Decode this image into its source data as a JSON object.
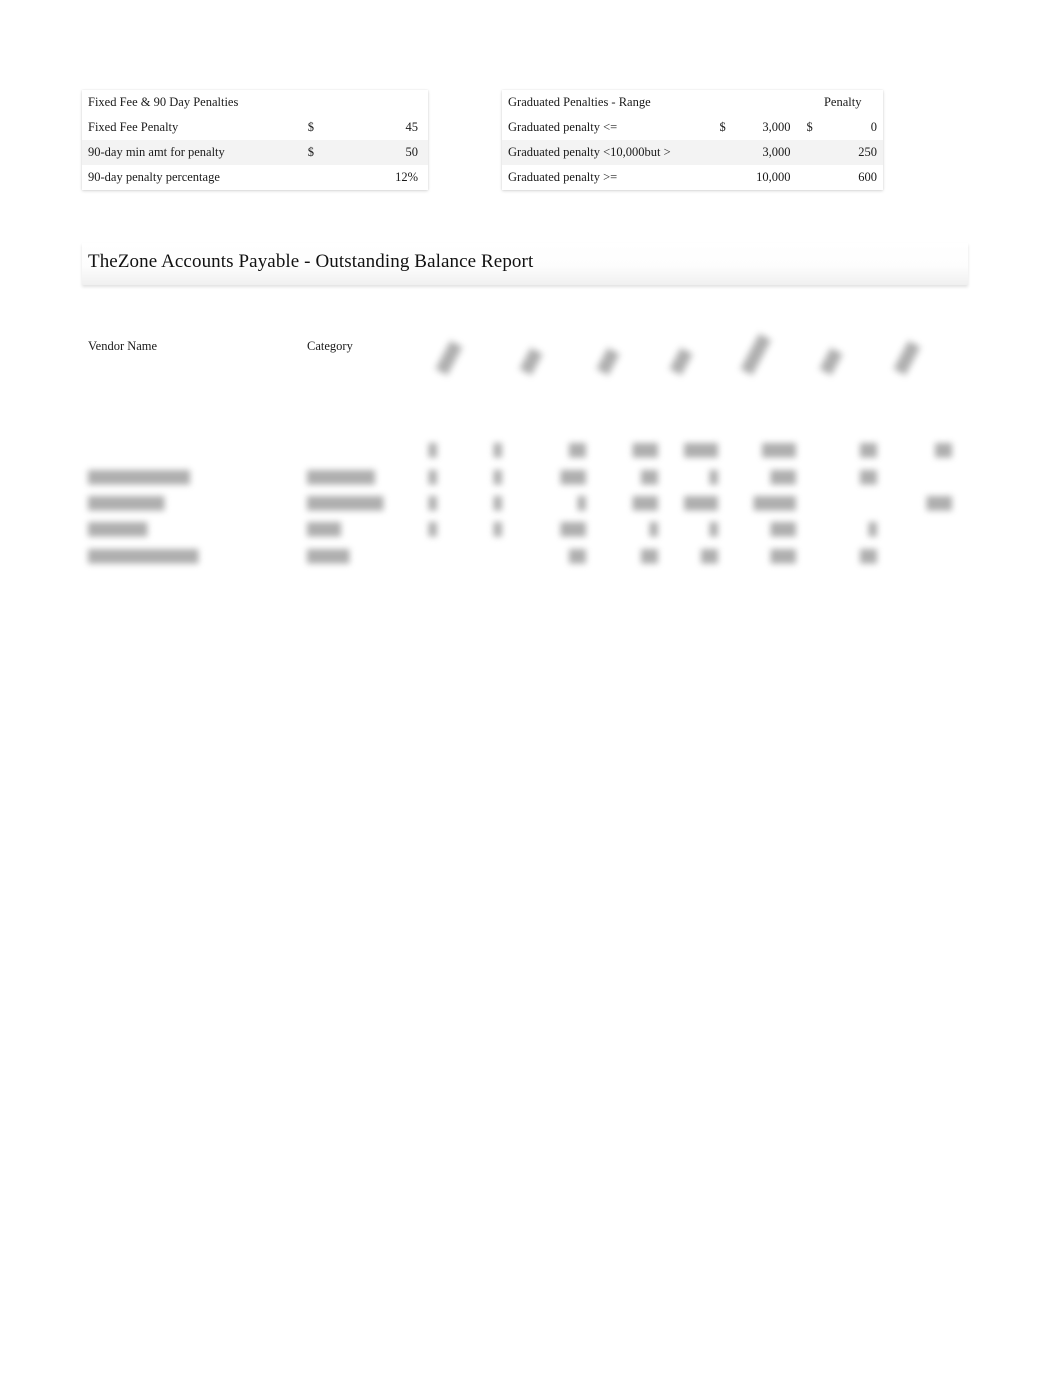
{
  "document": {
    "background_color": "#ffffff",
    "text_color": "#1a1a1a",
    "shade_color": "#f3f3f3"
  },
  "fixed_penalties_table": {
    "title": "Fixed   Fee & 90 Day Penalties",
    "rows": [
      {
        "label": "Fixed Fee Penalty",
        "currency": "$",
        "value": "45"
      },
      {
        "label": "90-day min amt for penalty",
        "currency": "$",
        "value": "50"
      },
      {
        "label": "90-day penalty percentage",
        "currency": "",
        "value": "12%"
      }
    ]
  },
  "graduated_penalties_table": {
    "title": "Graduated Penalties - Range",
    "penalty_header": "Penalty",
    "rows": [
      {
        "label": "Graduated penalty <=",
        "currency": "$",
        "range": "3,000",
        "penalty_currency": "$",
        "penalty": "0"
      },
      {
        "label": "Graduated penalty <10,000but >",
        "currency": "",
        "range": "3,000",
        "penalty_currency": "",
        "penalty": "250"
      },
      {
        "label": "Graduated penalty >=",
        "currency": "",
        "range": "10,000",
        "penalty_currency": "",
        "penalty": "600"
      }
    ]
  },
  "report": {
    "title": "TheZone Accounts Payable - Outstanding Balance Report",
    "column_headers": {
      "vendor_name": "Vendor Name",
      "category": "Category"
    },
    "rotated_headers": [
      {
        "label": "",
        "redacted": true
      },
      {
        "label": "",
        "redacted": true
      },
      {
        "label": "",
        "redacted": true
      },
      {
        "label": "",
        "redacted": true
      },
      {
        "label": "",
        "redacted": true
      },
      {
        "label": "",
        "redacted": true
      },
      {
        "label": "",
        "redacted": true
      }
    ],
    "rows": [
      {
        "vendor": "",
        "category": "",
        "values": [
          "",
          "",
          "",
          "",
          "",
          "",
          "",
          ""
        ],
        "redacted": true
      },
      {
        "vendor": "",
        "category": "",
        "values": [
          "",
          "",
          "",
          "",
          "",
          "",
          "",
          ""
        ],
        "redacted": true
      },
      {
        "vendor": "",
        "category": "",
        "values": [
          "",
          "",
          "",
          "",
          "",
          "",
          "",
          ""
        ],
        "redacted": true
      },
      {
        "vendor": "",
        "category": "",
        "values": [
          "",
          "",
          "",
          "",
          "",
          "",
          "",
          ""
        ],
        "redacted": true
      }
    ]
  }
}
